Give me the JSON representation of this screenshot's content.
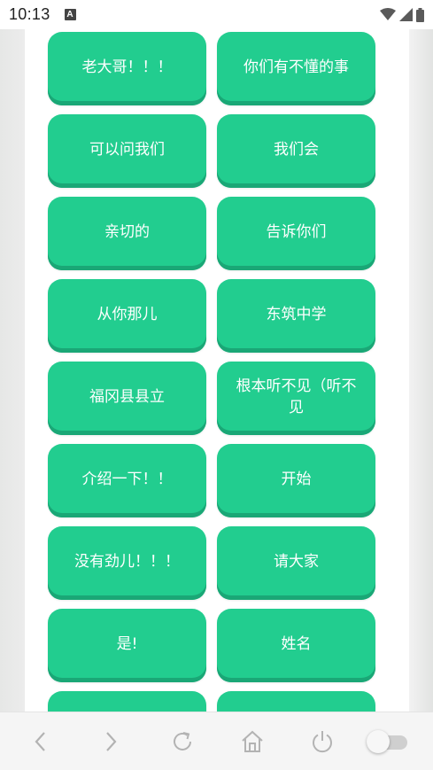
{
  "status_bar": {
    "time": "10:13",
    "notification_icon_letter": "A",
    "icons": [
      "wifi-icon",
      "cell-signal-icon",
      "battery-icon"
    ]
  },
  "phrases": [
    "老大哥！！！",
    "你们有不懂的事",
    "可以问我们",
    "我们会",
    "亲切的",
    "告诉你们",
    "从你那儿",
    "东筑中学",
    "福冈县县立",
    "根本听不见（听不见",
    "介绍一下！！",
    "开始",
    "没有劲儿！！！",
    "请大家",
    "是!",
    "姓名",
    "",
    ""
  ],
  "nav_bar": {
    "icons": [
      "back-icon",
      "forward-icon",
      "refresh-icon",
      "home-icon",
      "power-icon",
      "toggle-switch"
    ]
  },
  "colors": {
    "button": "#22cd8f",
    "button_shadow": "#1aa776",
    "button_text": "#ffffff"
  }
}
